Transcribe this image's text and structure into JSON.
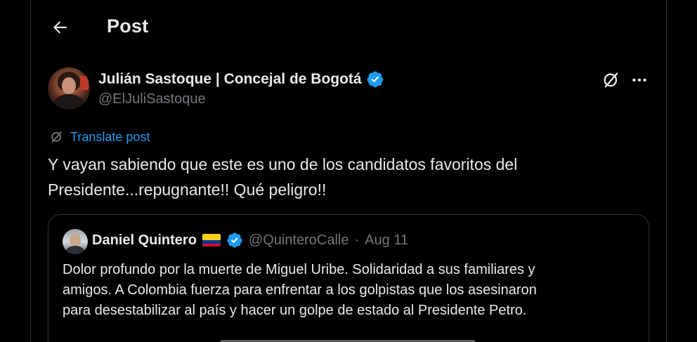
{
  "header": {
    "back_icon": "arrow-left-icon",
    "title": "Post"
  },
  "author": {
    "name": "Julián Sastoque | Concejal de Bogotá",
    "handle": "@ElJuliSastoque",
    "verified_icon": "verified-badge-icon",
    "verified_color": "#1d9bf0"
  },
  "actions": {
    "grok_icon": "grok-icon",
    "more_icon": "more-horizontal-icon"
  },
  "translate": {
    "label": "Translate post",
    "icon": "grok-translate-icon"
  },
  "post": {
    "text_line1": "Y vayan sabiendo que este es uno de los candidatos favoritos del",
    "text_line2": "Presidente...repugnante!! Qué peligro!!"
  },
  "quote": {
    "name": "Daniel Quintero",
    "flag": "colombia-flag",
    "handle": "@QuinteroCalle",
    "separator": "·",
    "date": "Aug 11",
    "text_line1": "Dolor profundo por la muerte de Miguel Uribe. Solidaridad a sus familiares y",
    "text_line2": "amigos. A Colombia fuerza para enfrentar a los golpistas que los asesinaron",
    "text_line3": "para desestabilizar al país y hacer un golpe de estado al Presidente Petro."
  },
  "colors": {
    "background": "#000000",
    "text_primary": "#e7e9ea",
    "text_secondary": "#71767b",
    "accent": "#1d9bf0",
    "border": "#2f3336"
  }
}
